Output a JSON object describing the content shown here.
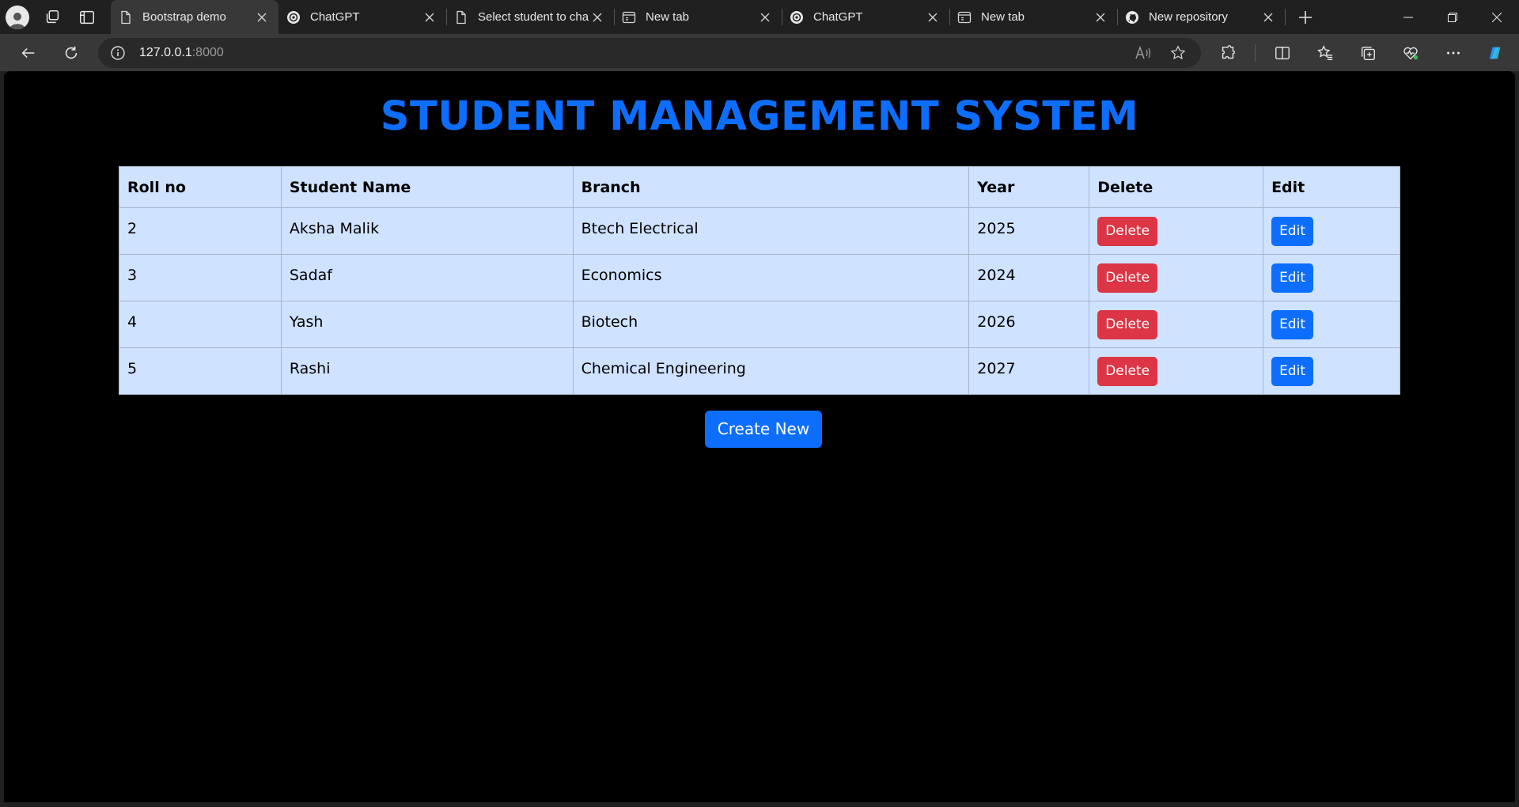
{
  "browser": {
    "tabs": [
      {
        "title": "Bootstrap demo",
        "favicon": "page-icon",
        "active": true
      },
      {
        "title": "ChatGPT",
        "favicon": "chatgpt-icon",
        "active": false
      },
      {
        "title": "Select student to cha",
        "favicon": "page-icon",
        "active": false
      },
      {
        "title": "New tab",
        "favicon": "newtab-icon",
        "active": false
      },
      {
        "title": "ChatGPT",
        "favicon": "chatgpt-icon",
        "active": false
      },
      {
        "title": "New tab",
        "favicon": "newtab-icon",
        "active": false
      },
      {
        "title": "New repository",
        "favicon": "github-icon",
        "active": false
      }
    ],
    "address": {
      "host": "127.0.0.1",
      "port": ":8000"
    }
  },
  "page": {
    "title": "STUDENT MANAGEMENT SYSTEM",
    "columns": [
      "Roll no",
      "Student Name",
      "Branch",
      "Year",
      "Delete",
      "Edit"
    ],
    "rows": [
      {
        "roll": "2",
        "name": "Aksha Malik",
        "branch": "Btech Electrical",
        "year": "2025"
      },
      {
        "roll": "3",
        "name": "Sadaf",
        "branch": "Economics",
        "year": "2024"
      },
      {
        "roll": "4",
        "name": "Yash",
        "branch": "Biotech",
        "year": "2026"
      },
      {
        "roll": "5",
        "name": "Rashi",
        "branch": "Chemical Engineering",
        "year": "2027"
      }
    ],
    "delete_label": "Delete",
    "edit_label": "Edit",
    "create_label": "Create New"
  },
  "colors": {
    "title": "#0d6efd",
    "table_bg": "#cfe2ff",
    "delete": "#dc3545",
    "primary": "#0d6efd"
  }
}
